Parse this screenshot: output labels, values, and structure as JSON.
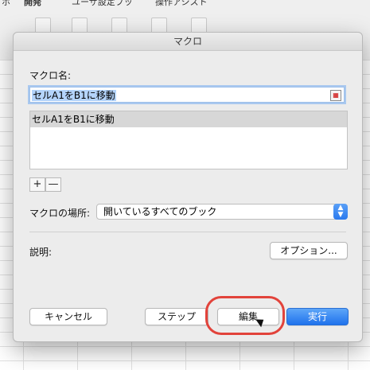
{
  "ribbon": {
    "tabs": [
      "ホ",
      "開発",
      "ユーザ設定ブッ",
      "操作アシスト"
    ]
  },
  "dialog": {
    "title": "マクロ",
    "macro_name_label": "マクロ名:",
    "macro_name_value": "セルA1をB1に移動",
    "macros": [
      "セルA1をB1に移動"
    ],
    "plus_label": "+",
    "minus_label": "—",
    "location_label": "マクロの場所:",
    "location_value": "開いているすべてのブック",
    "description_label": "説明:",
    "options_button": "オプション...",
    "cancel_button": "キャンセル",
    "step_button": "ステップ",
    "edit_button": "編集",
    "run_button": "実行"
  },
  "colors": {
    "primary_button": "#1f72ec",
    "highlight_ring": "#e2433b",
    "selection": "#b4d4fb"
  }
}
